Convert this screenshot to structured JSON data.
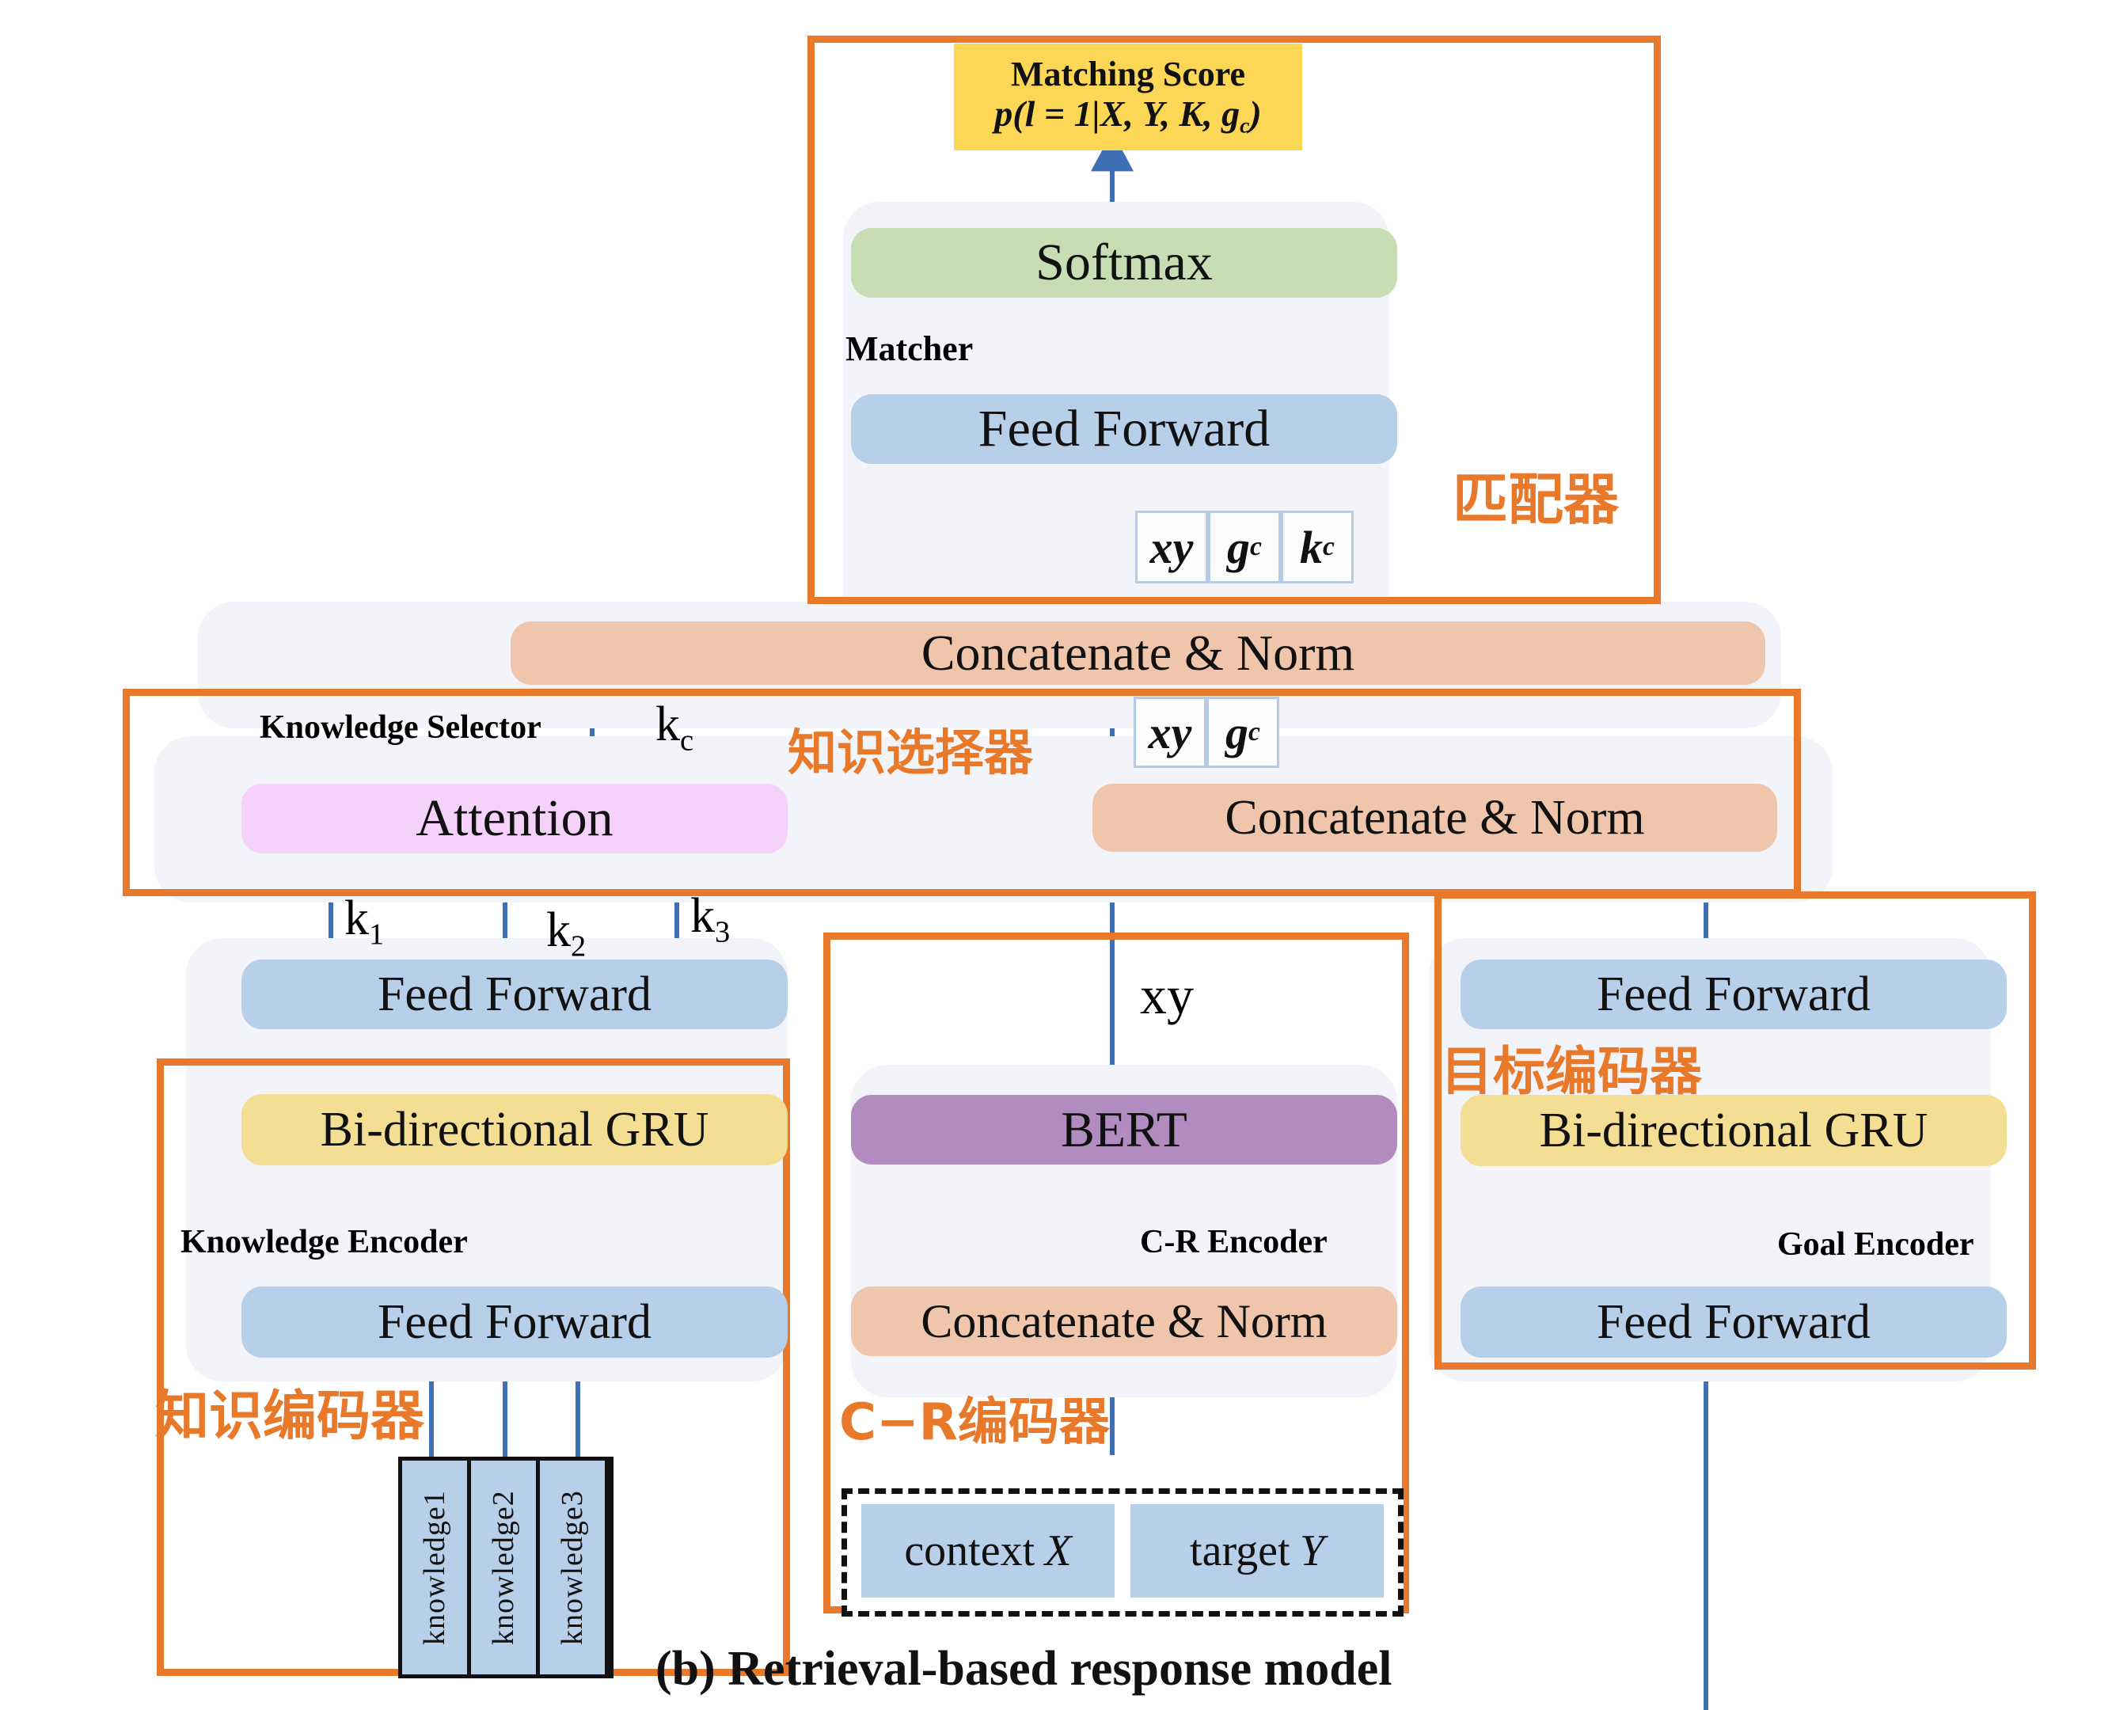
{
  "figure": {
    "caption": "(b) Retrieval-based response model"
  },
  "matcher": {
    "title_en": "Matcher",
    "title_cn": "匹配器",
    "score_title": "Matching Score",
    "score_formula_prefix": "p(l = 1|X, Y, K, g",
    "score_formula_sub": "c",
    "score_formula_suffix": ")",
    "softmax_label": "Softmax",
    "feed_forward_label": "Feed Forward",
    "input_cells": [
      {
        "base": "xy",
        "sub": ""
      },
      {
        "base": "g",
        "sub": "c"
      },
      {
        "base": "k",
        "sub": "c"
      }
    ]
  },
  "top_concat": {
    "label": "Concatenate & Norm"
  },
  "knowledge_selector": {
    "title_en": "Knowledge Selector",
    "title_cn": "知识选择器",
    "output_label_base": "k",
    "output_label_sub": "c",
    "attention_label": "Attention",
    "concat_label": "Concatenate & Norm",
    "input_cells": [
      {
        "base": "xy",
        "sub": ""
      },
      {
        "base": "g",
        "sub": "c"
      }
    ]
  },
  "knowledge_encoder": {
    "title_en": "Knowledge Encoder",
    "title_cn": "知识编码器",
    "top_feed_forward_label": "Feed Forward",
    "gru_label": "Bi-directional GRU",
    "bottom_feed_forward_label": "Feed Forward",
    "output_labels": [
      {
        "base": "k",
        "sub": "1"
      },
      {
        "base": "k",
        "sub": "2"
      },
      {
        "base": "k",
        "sub": "3"
      }
    ],
    "knowledge_items": [
      "knowledge1",
      "knowledge2",
      "knowledge3"
    ]
  },
  "cr_encoder": {
    "title_en": "C-R  Encoder",
    "title_cn": "C−R编码器",
    "output_label": "xy",
    "bert_label": "BERT",
    "concat_label": "Concatenate & Norm",
    "inputs": [
      {
        "text": "context ",
        "italic": "X"
      },
      {
        "text": "target ",
        "italic": "Y"
      }
    ]
  },
  "goal_encoder": {
    "title_en": "Goal  Encoder",
    "title_cn": "目标编码器",
    "top_feed_forward_label": "Feed Forward",
    "gru_label": "Bi-directional GRU",
    "bottom_feed_forward_label": "Feed Forward"
  },
  "colors": {
    "frame_orange": "#e8792a",
    "arrow_blue": "#3f6fb5",
    "panel_bg": "#f3f4f9",
    "feed_forward_blue": "#b7cfe8",
    "softmax_green": "#c7ddb4",
    "concat_peach": "#efc5ab",
    "attention_pink": "#f5d2f9",
    "gru_yellow": "#f3de93",
    "bert_purple": "#b18cc0",
    "score_gold": "#fcd655"
  }
}
